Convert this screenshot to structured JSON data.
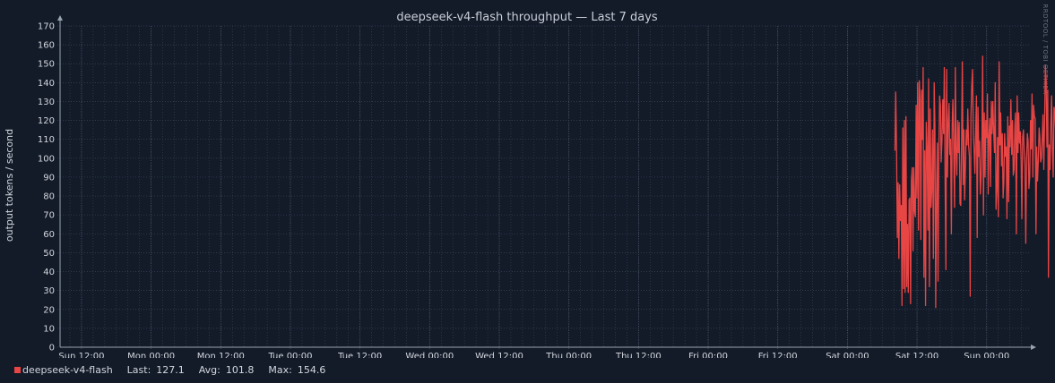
{
  "chart_data": {
    "type": "line",
    "title": "deepseek-v4-flash throughput — Last 7 days",
    "ylabel": "output tokens / second",
    "xlabel": "",
    "ylim": [
      0,
      170
    ],
    "yticks": [
      0,
      10,
      20,
      30,
      40,
      50,
      60,
      70,
      80,
      90,
      100,
      110,
      120,
      130,
      140,
      150,
      160,
      170
    ],
    "xticks": [
      "Sun 12:00",
      "Mon 00:00",
      "Mon 12:00",
      "Tue 00:00",
      "Tue 12:00",
      "Wed 00:00",
      "Wed 12:00",
      "Thu 00:00",
      "Thu 12:00",
      "Fri 00:00",
      "Fri 12:00",
      "Sat 00:00",
      "Sat 12:00",
      "Sun 00:00"
    ],
    "x_range_hours": [
      -3.7,
      163.3
    ],
    "grid": true,
    "watermark": "RRDTOOL / TOBI OETIKER",
    "series": [
      {
        "name": "deepseek-v4-flash",
        "color": "#e84545",
        "x_start_hours": 140.2,
        "x_step_hours": 0.135,
        "values": [
          104,
          135,
          105,
          58,
          87,
          47,
          86,
          67,
          75,
          22,
          116,
          31,
          120,
          29,
          122,
          32,
          65,
          29,
          78,
          79,
          23,
          88,
          95,
          51,
          95,
          72,
          69,
          128,
          79,
          140,
          62,
          141,
          131,
          57,
          136,
          110,
          148,
          37,
          104,
          22,
          119,
          106,
          62,
          142,
          32,
          126,
          74,
          83,
          115,
          47,
          140,
          118,
          21,
          79,
          108,
          35,
          103,
          133,
          128,
          98,
          109,
          131,
          113,
          148,
          87,
          41,
          147,
          90,
          119,
          129,
          102,
          110,
          60,
          117,
          131,
          106,
          74,
          148,
          104,
          91,
          120,
          103,
          119,
          76,
          75,
          110,
          151,
          86,
          115,
          78,
          96,
          115,
          107,
          126,
          107,
          101,
          27,
          121,
          138,
          147,
          113,
          105,
          92,
          114,
          133,
          58,
          127,
          101,
          109,
          81,
          91,
          110,
          154,
          70,
          124,
          90,
          120,
          111,
          134,
          81,
          112,
          121,
          85,
          130,
          113,
          130,
          114,
          103,
          140,
          73,
          83,
          111,
          69,
          151,
          107,
          124,
          96,
          113,
          79,
          87,
          113,
          101,
          106,
          68,
          122,
          77,
          117,
          106,
          131,
          102,
          120,
          91,
          94,
          117,
          124,
          60,
          133,
          103,
          124,
          108,
          114,
          99,
          68,
          111,
          115,
          103,
          97,
          55,
          100,
          113,
          109,
          84,
          90,
          120,
          105,
          134,
          90,
          128,
          122,
          121,
          60,
          106,
          88,
          99,
          116,
          111,
          98,
          100,
          111,
          123,
          94,
          120,
          149,
          141,
          106,
          136,
          37,
          107,
          94,
          118,
          133,
          105,
          90,
          127,
          125,
          116,
          98,
          112,
          100,
          84,
          110,
          92,
          109,
          121,
          113,
          103,
          111,
          112,
          116,
          83,
          98,
          114,
          102,
          110,
          128,
          122,
          100,
          131,
          113,
          97,
          120,
          85,
          91,
          103,
          100,
          115,
          114,
          105,
          118,
          100,
          93,
          121,
          110,
          86,
          127,
          102,
          114,
          57,
          117,
          104,
          128,
          55,
          120,
          112,
          126,
          113,
          86,
          102,
          135,
          127,
          70,
          69
        ]
      }
    ],
    "legend": {
      "name": "deepseek-v4-flash",
      "last_label": "Last:",
      "last_value": "127.1",
      "avg_label": "Avg:",
      "avg_value": "101.8",
      "max_label": "Max:",
      "max_value": "154.6"
    },
    "colors": {
      "background": "#131b29",
      "grid": "#3a4556",
      "axis": "#9aa3b0",
      "text": "#d3d7de",
      "series": "#e84545"
    }
  }
}
